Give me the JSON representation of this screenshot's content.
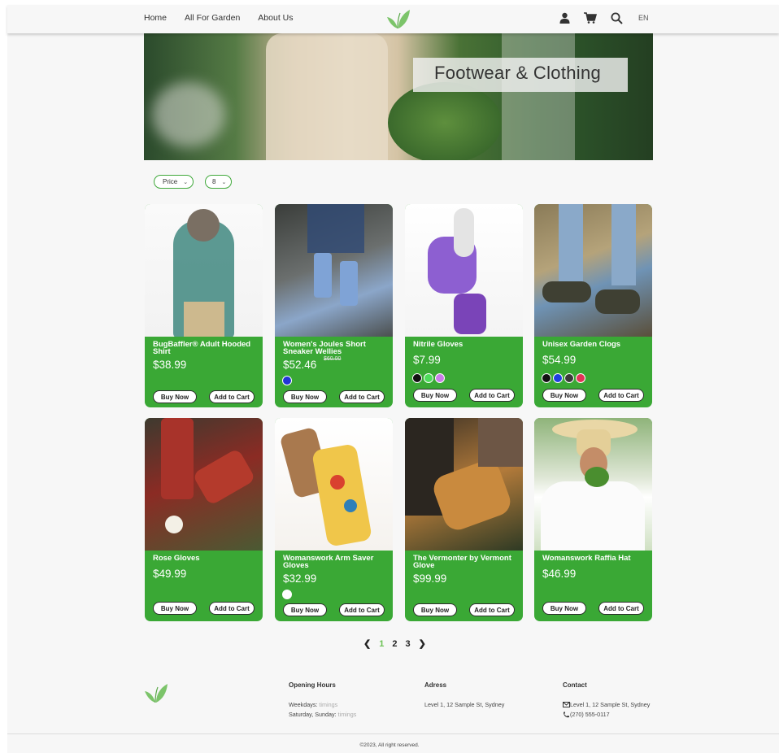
{
  "header": {
    "nav": [
      "Home",
      "All For Garden",
      "About Us"
    ],
    "lang": "EN"
  },
  "hero": {
    "title": "Footwear & Clothing"
  },
  "filters": {
    "sort": "Price",
    "per_page": "8"
  },
  "products": [
    {
      "name": "BugBaffler® Adult Hooded Shirt",
      "price": "$38.99",
      "old_price": "",
      "colors": [],
      "buy": "Buy Now",
      "add": "Add to Cart"
    },
    {
      "name": "Women's Joules Short Sneaker Wellies",
      "price": "$52.46",
      "old_price": "$60.00",
      "colors": [
        "#2235d6"
      ],
      "buy": "Buy Now",
      "add": "Add to Cart"
    },
    {
      "name": "Nitrile Gloves",
      "price": "$7.99",
      "old_price": "",
      "colors": [
        "#111111",
        "#4ddc5a",
        "#c97ee8"
      ],
      "buy": "Buy Now",
      "add": "Add to Cart"
    },
    {
      "name": "Unisex Garden Clogs",
      "price": "$54.99",
      "old_price": "",
      "colors": [
        "#111111",
        "#1f3fe0",
        "#3a3a3a",
        "#e23457"
      ],
      "buy": "Buy Now",
      "add": "Add to Cart"
    },
    {
      "name": "Rose Gloves",
      "price": "$49.99",
      "old_price": "",
      "colors": [],
      "buy": "Buy Now",
      "add": "Add to Cart"
    },
    {
      "name": "Womanswork Arm Saver Gloves",
      "price": "$32.99",
      "old_price": "",
      "colors": [
        "#ffffff"
      ],
      "buy": "Buy Now",
      "add": "Add to Cart"
    },
    {
      "name": "The Vermonter by Vermont Glove",
      "price": "$99.99",
      "old_price": "",
      "colors": [],
      "buy": "Buy Now",
      "add": "Add to Cart"
    },
    {
      "name": "Womanswork Raffia Hat",
      "price": "$46.99",
      "old_price": "",
      "colors": [],
      "buy": "Buy Now",
      "add": "Add to Cart"
    }
  ],
  "pagination": {
    "pages": [
      "1",
      "2",
      "3"
    ],
    "current": "1"
  },
  "footer": {
    "hours_title": "Opening Hours",
    "weekdays_label": "Weekdays:",
    "weekdays_value": " timings",
    "weekend_label": "Saturday, Sunday:",
    "weekend_value": " timings",
    "address_title": "Adress",
    "address": "Level 1, 12 Sample St, Sydney",
    "contact_title": "Contact",
    "contact_address": "Level 1, 12 Sample St, Sydney",
    "phone": "(270) 555-0117",
    "copyright": "©2023, All right reserved."
  },
  "colors": {
    "brand_green": "#3aa835",
    "accent_green": "#6cc255"
  }
}
